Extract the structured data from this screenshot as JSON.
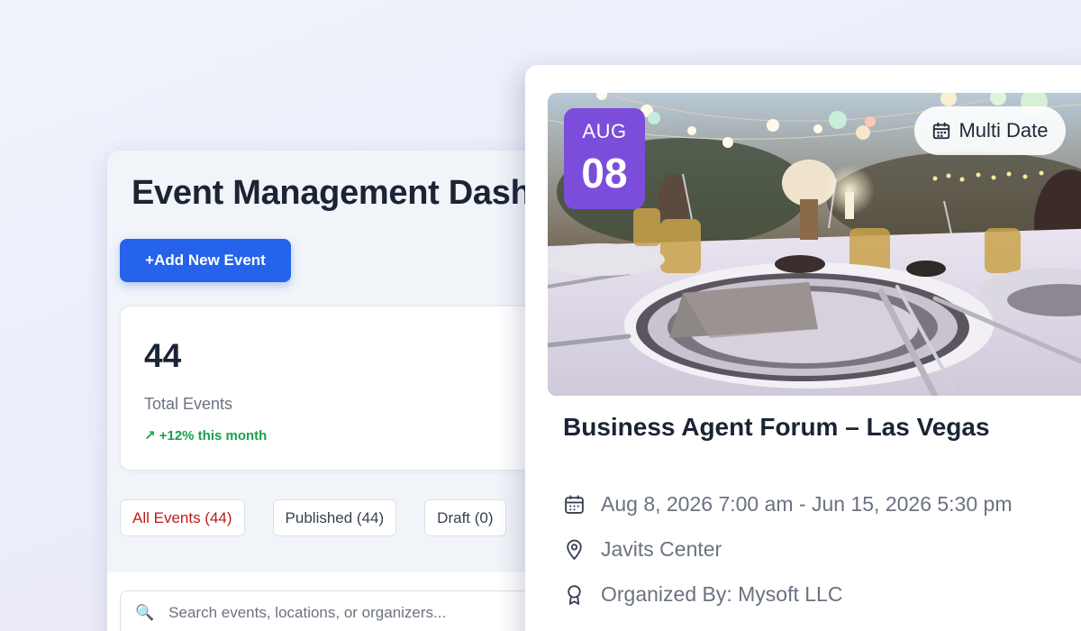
{
  "dashboard": {
    "title": "Event Management Dashboard",
    "add_button": "+Add New Event",
    "stats": {
      "total_value": "44",
      "total_label": "Total Events",
      "trend": "↗ +12% this month",
      "trend_color": "#16a34a"
    },
    "filters": [
      {
        "label": "All Events (44)",
        "active": true
      },
      {
        "label": "Published (44)",
        "active": false
      },
      {
        "label": "Draft (0)",
        "active": false
      }
    ],
    "search": {
      "placeholder": "Search events, locations, or organizers...",
      "icon": "search-icon"
    },
    "accent": "#2563eb"
  },
  "event_card": {
    "date_month": "AUG",
    "date_day": "08",
    "badge_color": "#7c4ddb",
    "multi_date_label": "Multi Date",
    "title": "Business Agent Forum – Las Vegas",
    "date_range": "Aug 8, 2026 7:00 am - Jun 15, 2026 5:30 pm",
    "location": "Javits Center",
    "organizer": "Organized By: Mysoft LLC",
    "icons": [
      "calendar-icon",
      "location-pin-icon",
      "award-icon"
    ]
  }
}
